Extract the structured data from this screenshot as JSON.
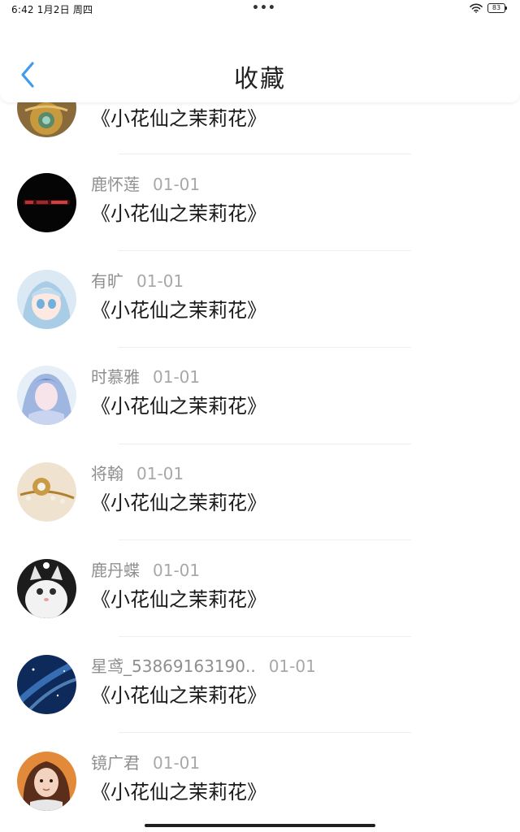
{
  "status_bar": {
    "time": "6:42  1月2日 周四",
    "dots": "•••",
    "battery": "83",
    "wifi_icon": "wifi-icon"
  },
  "header": {
    "title": "收藏",
    "back_icon": "chevron-left-icon",
    "accent_color": "#3f9bf0"
  },
  "favorites": {
    "items": [
      {
        "name": "",
        "date": "",
        "title": "《小花仙之茉莉花》",
        "avatar": "golden-ornament"
      },
      {
        "name": "鹿怀莲",
        "date": "01-01",
        "title": "《小花仙之茉莉花》",
        "avatar": "black-with-red-text"
      },
      {
        "name": "有旷",
        "date": "01-01",
        "title": "《小花仙之茉莉花》",
        "avatar": "anime-girl-blue-hair"
      },
      {
        "name": "时慕雅",
        "date": "01-01",
        "title": "《小花仙之茉莉花》",
        "avatar": "blue-fairy"
      },
      {
        "name": "将翰",
        "date": "01-01",
        "title": "《小花仙之茉莉花》",
        "avatar": "pearl-brooch"
      },
      {
        "name": "鹿丹蝶",
        "date": "01-01",
        "title": "《小花仙之茉莉花》",
        "avatar": "white-kitten"
      },
      {
        "name": "星鸢_53869163190..",
        "date": "01-01",
        "title": "《小花仙之茉莉花》",
        "avatar": "blue-night-sky"
      },
      {
        "name": "镜广君",
        "date": "01-01",
        "title": "《小花仙之茉莉花》",
        "avatar": "curly-hair-girl"
      }
    ]
  }
}
